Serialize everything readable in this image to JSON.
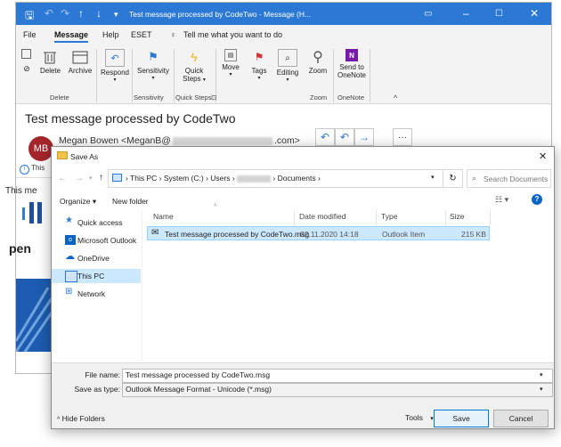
{
  "outlook": {
    "title": "Test message processed by CodeTwo  -  Message (H...",
    "menu": [
      "File",
      "Message",
      "Help",
      "ESET",
      "Tell me what you want to do"
    ],
    "ribbon": {
      "delete": "Delete",
      "archive": "Archive",
      "respond": "Respond",
      "sensitivity": "Sensitivity",
      "quick_steps_1": "Quick",
      "quick_steps_2": "Steps",
      "move": "Move",
      "tags": "Tags",
      "editing": "Editing",
      "zoom": "Zoom",
      "send_onenote_1": "Send to",
      "send_onenote_2": "OneNote",
      "groups": {
        "delete": "Delete",
        "sensitivity": "Sensitivity",
        "quick_steps": "Quick Steps",
        "zoom": "Zoom",
        "onenote": "OneNote"
      }
    },
    "subject": "Test message processed by CodeTwo",
    "avatar_initials": "MB",
    "sender": "Megan Bowen <MeganB@",
    "sender_suffix": ".com>",
    "info_text": "This",
    "body_text": "This me",
    "logo_text": "pen"
  },
  "dialog": {
    "title": "Save As",
    "breadcrumb": [
      "This PC",
      "System (C:)",
      "Users",
      "Documents"
    ],
    "search_placeholder": "Search Documents",
    "organize": "Organize ▾",
    "new_folder": "New folder",
    "nav_items": [
      "Quick access",
      "Microsoft Outlook",
      "OneDrive",
      "This PC",
      "Network"
    ],
    "columns": [
      "Name",
      "Date modified",
      "Type",
      "Size"
    ],
    "files": [
      {
        "name": "Test message processed by CodeTwo.msg",
        "date": "02.11.2020 14:18",
        "type": "Outlook Item",
        "size": "215 KB"
      }
    ],
    "file_name_label": "File name:",
    "file_name_value": "Test message processed by CodeTwo.msg",
    "save_type_label": "Save as type:",
    "save_type_value": "Outlook Message Format - Unicode (*.msg)",
    "hide_folders": "Hide Folders",
    "tools": "Tools",
    "save": "Save",
    "cancel": "Cancel"
  },
  "colors": {
    "accent": "#2b79d4",
    "avatar": "#a4262c",
    "selection": "#cce8ff"
  }
}
